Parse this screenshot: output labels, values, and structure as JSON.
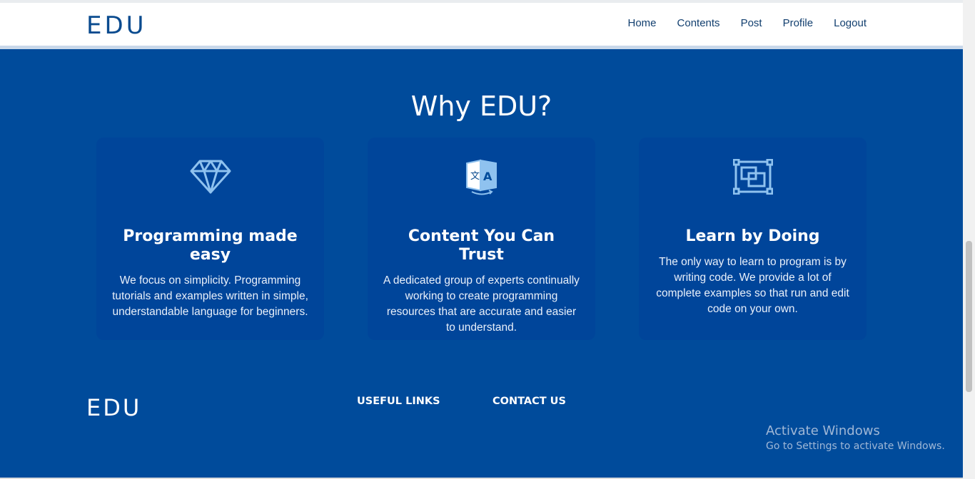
{
  "header": {
    "brand": "EDU",
    "nav": [
      "Home",
      "Contents",
      "Post",
      "Profile",
      "Logout"
    ]
  },
  "main": {
    "title": "Why EDU?",
    "cards": [
      {
        "icon": "diamond-icon",
        "title": "Programming made easy",
        "text": "We focus on simplicity. Programming tutorials and examples written in simple, understandable language for beginners."
      },
      {
        "icon": "translate-icon",
        "title": "Content You Can Trust",
        "text": "A dedicated group of experts continually working to create programming resources that are accurate and easier to understand."
      },
      {
        "icon": "layers-frame-icon",
        "title": "Learn by Doing",
        "text": "The only way to learn to program is by writing code. We provide a lot of complete examples so that run and edit code on your own."
      }
    ]
  },
  "footer": {
    "brand": "EDU",
    "useful_links": "USEFUL LINKS",
    "contact_us": "CONTACT US"
  },
  "watermark": {
    "line1": "Activate Windows",
    "line2": "Go to Settings to activate Windows."
  },
  "colors": {
    "primary": "#004b9b",
    "card": "#00459a",
    "icon": "#8fc2ef"
  }
}
